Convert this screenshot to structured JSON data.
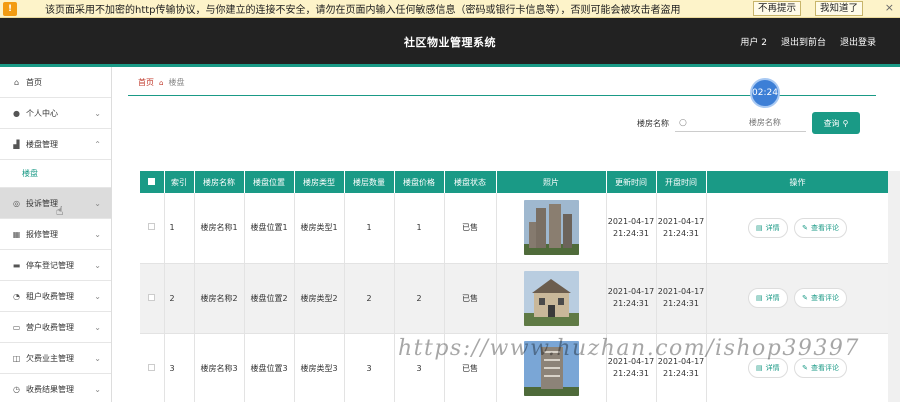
{
  "warning_bar": {
    "text": "该页面采用不加密的http传输协议，与你建立的连接不安全，请勿在页面内输入任何敏感信息（密码或银行卡信息等），否则可能会被攻击者盗用",
    "no_remind": "不再提示",
    "got_it": "我知道了",
    "close": "×"
  },
  "header": {
    "title": "社区物业管理系统",
    "user": "用户 2",
    "back_to_front": "退出到前台",
    "logout": "退出登录"
  },
  "sidebar": {
    "items": [
      {
        "label": "首页",
        "icon": "home-icon",
        "glyph": "⌂"
      },
      {
        "label": "个人中心",
        "icon": "user-icon",
        "glyph": "●"
      },
      {
        "label": "楼盘管理",
        "icon": "building-icon",
        "glyph": "▟",
        "expanded": true
      },
      {
        "label": "楼盘",
        "sub": true
      },
      {
        "label": "投诉管理",
        "icon": "complaint-icon",
        "glyph": "◎",
        "active": true
      },
      {
        "label": "报修管理",
        "icon": "repair-icon",
        "glyph": "▦"
      },
      {
        "label": "停车登记管理",
        "icon": "parking-icon",
        "glyph": "▬"
      },
      {
        "label": "租户收费管理",
        "icon": "fee-icon",
        "glyph": "◔"
      },
      {
        "label": "营户收费管理",
        "icon": "payment-icon",
        "glyph": "▭"
      },
      {
        "label": "欠费业主管理",
        "icon": "arrears-icon",
        "glyph": "◫"
      },
      {
        "label": "收费结果管理",
        "icon": "result-icon",
        "glyph": "◷"
      }
    ]
  },
  "breadcrumb": {
    "home": "首页",
    "current": "楼盘"
  },
  "timer": "02:24",
  "search": {
    "label": "楼房名称",
    "placeholder": "楼房名称",
    "button": "查询"
  },
  "table": {
    "headers": [
      "索引",
      "楼房名称",
      "楼盘位置",
      "楼房类型",
      "楼层数量",
      "楼盘价格",
      "楼盘状态",
      "照片",
      "更新时间",
      "开盘时间",
      "操作"
    ],
    "rows": [
      {
        "index": "1",
        "name": "楼房名称1",
        "location": "楼盘位置1",
        "type": "楼房类型1",
        "floors": "1",
        "price": "1",
        "status": "已售",
        "updated": "2021-04-17 21:24:31",
        "opened": "2021-04-17 21:24:31"
      },
      {
        "index": "2",
        "name": "楼房名称2",
        "location": "楼盘位置2",
        "type": "楼房类型2",
        "floors": "2",
        "price": "2",
        "status": "已售",
        "updated": "2021-04-17 21:24:31",
        "opened": "2021-04-17 21:24:31"
      },
      {
        "index": "3",
        "name": "楼房名称3",
        "location": "楼盘位置3",
        "type": "楼房类型3",
        "floors": "3",
        "price": "3",
        "status": "已售",
        "updated": "2021-04-17 21:24:31",
        "opened": "2021-04-17 21:24:31"
      }
    ],
    "actions": {
      "detail": "详情",
      "comments": "查看评论"
    }
  },
  "watermark": "https://www.huzhan.com/ishop39397",
  "colors": {
    "accent": "#1a9a86",
    "header_bg": "#222222",
    "warning_bg": "#fdf3c9",
    "timer": "#3d7fd6"
  }
}
